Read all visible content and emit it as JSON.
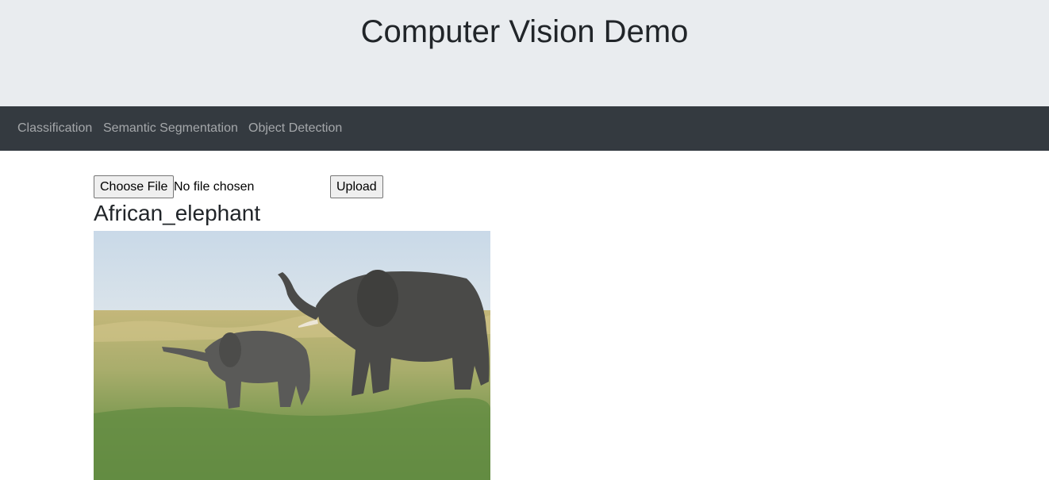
{
  "header": {
    "title": "Computer Vision Demo"
  },
  "nav": {
    "items": [
      {
        "label": "Classification"
      },
      {
        "label": "Semantic Segmentation"
      },
      {
        "label": "Object Detection"
      }
    ]
  },
  "upload_form": {
    "choose_file_label": "Choose File",
    "file_status": "No file chosen",
    "upload_label": "Upload"
  },
  "result": {
    "label": "African_elephant",
    "image_description_icon": "photo-of-elephants"
  },
  "colors": {
    "header_bg": "#e9ecef",
    "navbar_bg": "#343a40",
    "nav_link": "rgba(255,255,255,0.55)",
    "text": "#212529"
  }
}
